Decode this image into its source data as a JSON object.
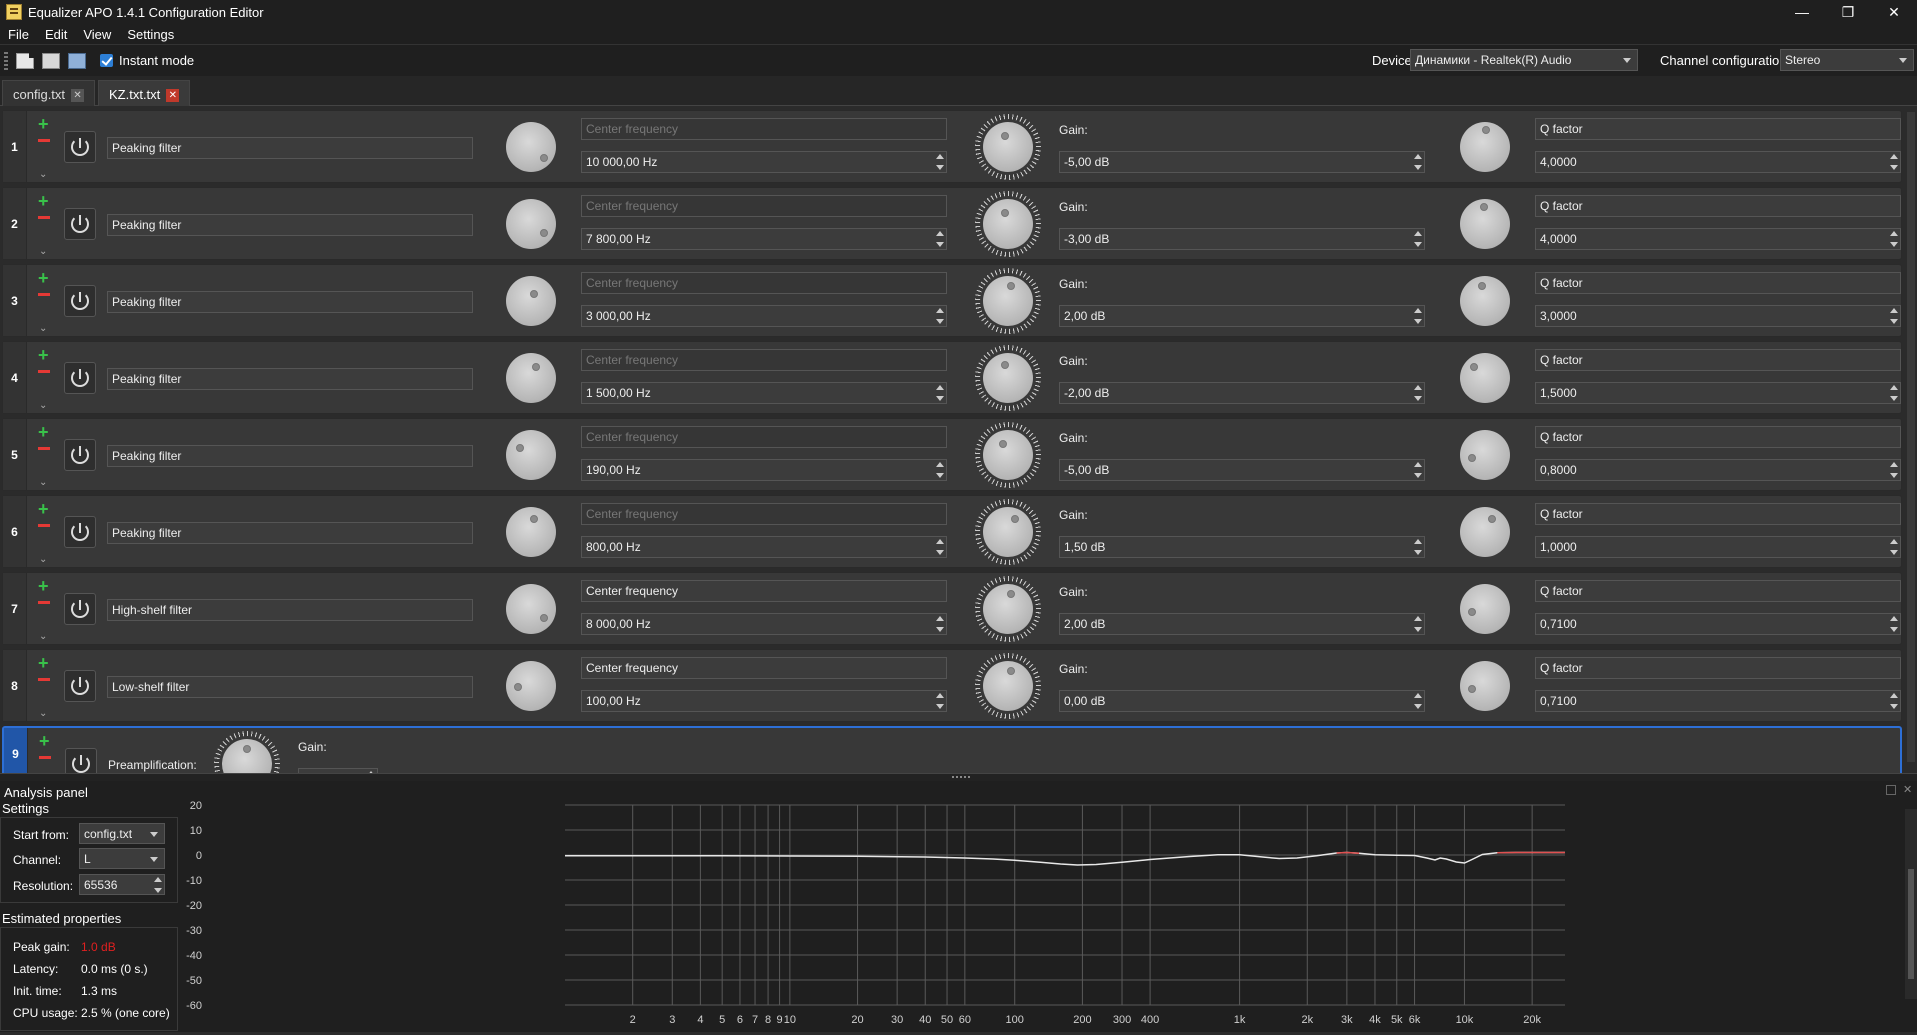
{
  "window": {
    "title": "Equalizer APO 1.4.1 Configuration Editor",
    "minimize": "—",
    "maximize": "❐",
    "close": "✕"
  },
  "menu": [
    "File",
    "Edit",
    "View",
    "Settings"
  ],
  "toolbar": {
    "instant_mode_label": "Instant mode",
    "instant_mode_checked": true,
    "device_label": "Device:",
    "device_value": "Динамики - Realtek(R) Audio",
    "channel_config_label": "Channel configuration:",
    "channel_config_value": "Stereo"
  },
  "tabs": [
    {
      "label": "config.txt",
      "active": false
    },
    {
      "label": "KZ.txt.txt",
      "active": true
    }
  ],
  "filters": [
    {
      "num": "1",
      "type": "Peaking filter",
      "freq_param": "Center frequency",
      "freq_enabled": false,
      "freq": "10 000,00 Hz",
      "gain_label": "Gain:",
      "gain": "-5,00 dB",
      "q_param": "Q factor",
      "q": "4,0000"
    },
    {
      "num": "2",
      "type": "Peaking filter",
      "freq_param": "Center frequency",
      "freq_enabled": false,
      "freq": "7 800,00 Hz",
      "gain_label": "Gain:",
      "gain": "-3,00 dB",
      "q_param": "Q factor",
      "q": "4,0000"
    },
    {
      "num": "3",
      "type": "Peaking filter",
      "freq_param": "Center frequency",
      "freq_enabled": false,
      "freq": "3 000,00 Hz",
      "gain_label": "Gain:",
      "gain": "2,00 dB",
      "q_param": "Q factor",
      "q": "3,0000"
    },
    {
      "num": "4",
      "type": "Peaking filter",
      "freq_param": "Center frequency",
      "freq_enabled": false,
      "freq": "1 500,00 Hz",
      "gain_label": "Gain:",
      "gain": "-2,00 dB",
      "q_param": "Q factor",
      "q": "1,5000"
    },
    {
      "num": "5",
      "type": "Peaking filter",
      "freq_param": "Center frequency",
      "freq_enabled": false,
      "freq": "190,00 Hz",
      "gain_label": "Gain:",
      "gain": "-5,00 dB",
      "q_param": "Q factor",
      "q": "0,8000"
    },
    {
      "num": "6",
      "type": "Peaking filter",
      "freq_param": "Center frequency",
      "freq_enabled": false,
      "freq": "800,00 Hz",
      "gain_label": "Gain:",
      "gain": "1,50 dB",
      "q_param": "Q factor",
      "q": "1,0000"
    },
    {
      "num": "7",
      "type": "High-shelf filter",
      "freq_param": "Center frequency",
      "freq_enabled": true,
      "freq": "8 000,00 Hz",
      "gain_label": "Gain:",
      "gain": "2,00 dB",
      "q_param": "Q factor",
      "q": "0,7100"
    },
    {
      "num": "8",
      "type": "Low-shelf filter",
      "freq_param": "Center frequency",
      "freq_enabled": true,
      "freq": "100,00 Hz",
      "gain_label": "Gain:",
      "gain": "0,00 dB",
      "q_param": "Q factor",
      "q": "0,7100"
    }
  ],
  "preamp": {
    "num": "9",
    "label": "Preamplification:",
    "gain_label": "Gain:"
  },
  "analysis": {
    "title": "Analysis panel",
    "settings_label": "Settings",
    "start_from_label": "Start from:",
    "start_from_value": "config.txt",
    "channel_label": "Channel:",
    "channel_value": "L",
    "resolution_label": "Resolution:",
    "resolution_value": "65536",
    "estimated_label": "Estimated properties",
    "peak_gain_label": "Peak gain:",
    "peak_gain_value": "1.0 dB",
    "latency_label": "Latency:",
    "latency_value": "0.0 ms (0 s.)",
    "init_time_label": "Init. time:",
    "init_time_value": "1.3 ms",
    "cpu_label": "CPU usage:",
    "cpu_value": "2.5 % (one core)"
  },
  "colors": {
    "accent": "#2d6fd6",
    "plus": "#39c24a",
    "minus": "#e53935",
    "curve": "#e8e8e8",
    "curve_clip": "#e05050",
    "peak": "#e02020"
  },
  "chart_data": {
    "type": "line",
    "title": "",
    "xlabel": "",
    "ylabel": "",
    "x_scale": "log",
    "xlim": [
      1,
      28000
    ],
    "ylim": [
      -60,
      20
    ],
    "y_ticks": [
      "20",
      "10",
      "0",
      "-10",
      "-20",
      "-30",
      "-40",
      "-50",
      "-60"
    ],
    "x_ticks": [
      {
        "v": 2,
        "l": "2"
      },
      {
        "v": 3,
        "l": "3"
      },
      {
        "v": 4,
        "l": "4"
      },
      {
        "v": 5,
        "l": "5"
      },
      {
        "v": 6,
        "l": "6"
      },
      {
        "v": 7,
        "l": "7"
      },
      {
        "v": 8,
        "l": "8"
      },
      {
        "v": 9,
        "l": "9"
      },
      {
        "v": 10,
        "l": "10"
      },
      {
        "v": 20,
        "l": "20"
      },
      {
        "v": 30,
        "l": "30"
      },
      {
        "v": 40,
        "l": "40"
      },
      {
        "v": 50,
        "l": "50"
      },
      {
        "v": 60,
        "l": "60"
      },
      {
        "v": 100,
        "l": "100"
      },
      {
        "v": 200,
        "l": "200"
      },
      {
        "v": 300,
        "l": "300"
      },
      {
        "v": 400,
        "l": "400"
      },
      {
        "v": 1000,
        "l": "1k"
      },
      {
        "v": 2000,
        "l": "2k"
      },
      {
        "v": 3000,
        "l": "3k"
      },
      {
        "v": 4000,
        "l": "4k"
      },
      {
        "v": 5000,
        "l": "5k"
      },
      {
        "v": 6000,
        "l": "6k"
      },
      {
        "v": 10000,
        "l": "10k"
      },
      {
        "v": 20000,
        "l": "20k"
      }
    ],
    "grid": true,
    "series": [
      {
        "x": [
          1,
          5,
          10,
          20,
          40,
          60,
          80,
          100,
          130,
          160,
          190,
          230,
          300,
          400,
          600,
          800,
          1000,
          1300,
          1500,
          1800,
          2200,
          2700,
          3000,
          3400,
          4000,
          5000,
          6000,
          6800,
          7400,
          7800,
          8300,
          9200,
          10000,
          10800,
          12000,
          14000,
          17000,
          20000,
          24000,
          28000
        ],
        "y": [
          -0.3,
          -0.3,
          -0.4,
          -0.5,
          -0.8,
          -1.2,
          -1.6,
          -2.1,
          -2.9,
          -3.6,
          -4.0,
          -3.8,
          -2.9,
          -1.8,
          -0.6,
          0.1,
          0.1,
          -0.9,
          -1.4,
          -1.2,
          -0.3,
          0.8,
          1.0,
          0.7,
          0.1,
          -0.1,
          -0.2,
          -1.2,
          -2.0,
          -1.2,
          -1.6,
          -2.8,
          -3.2,
          -1.8,
          0.2,
          0.9,
          1.0,
          1.0,
          1.0,
          1.0
        ]
      }
    ]
  }
}
